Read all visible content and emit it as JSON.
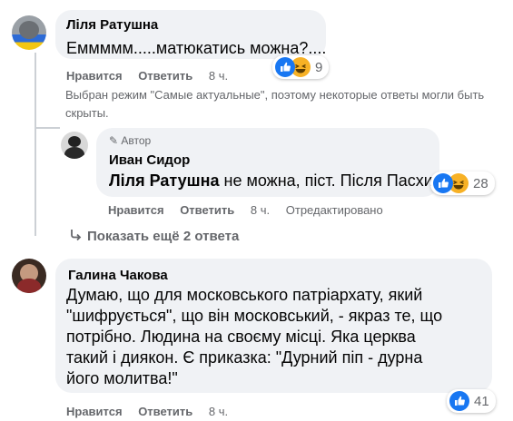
{
  "comments": [
    {
      "author": "Ліля Ратушна",
      "text": "Еммммм.....матюкатись можна?....",
      "like_label": "Нравится",
      "reply_label": "Ответить",
      "time": "8 ч.",
      "reaction_count": "9"
    },
    {
      "author_badge": "Автор",
      "author": "Иван Сидор",
      "mention": "Ліля Ратушна",
      "text": " не можна, піст. Після Пасхи.",
      "like_label": "Нравится",
      "reply_label": "Ответить",
      "time": "8 ч.",
      "edited": "Отредактировано",
      "reaction_count": "28"
    },
    {
      "author": "Галина Чакова",
      "text": "Думаю, що для московського патріархату, який \"шифрується\", що він московський, - якраз те, що потрібно. Людина на своєму місці. Яка церква такий і диякон. Є приказка: \"Дурний піп - дурна його молитва!\"",
      "like_label": "Нравится",
      "reply_label": "Ответить",
      "time": "8 ч.",
      "reaction_count": "41"
    }
  ],
  "notice": "Выбран режим \"Самые актуальные\", поэтому некоторые ответы могли быть скрыты.",
  "show_more": "Показать ещё 2 ответа",
  "colors": {
    "like": "#1877f2",
    "haha": "#f7b125",
    "bubble": "#f0f2f5",
    "secondary_text": "#65676b"
  }
}
